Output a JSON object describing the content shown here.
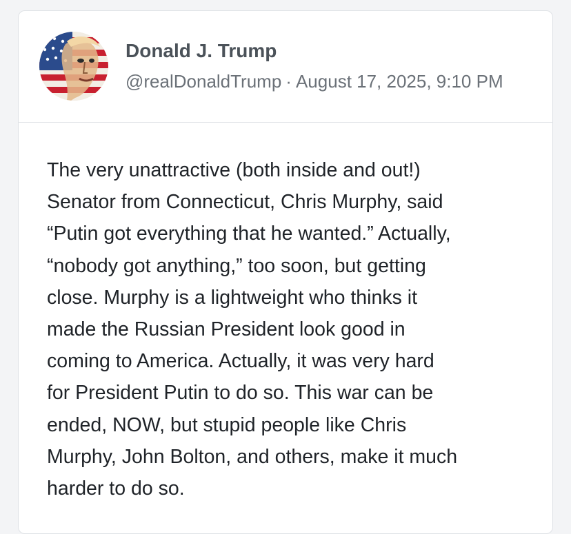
{
  "post": {
    "author_name": "Donald J. Trump",
    "handle": "@realDonaldTrump",
    "separator": "·",
    "timestamp": "August 17, 2025, 9:10 PM",
    "avatar_icon": "flag-portrait-avatar",
    "lines": [
      "The very unattractive (both inside and out!)",
      "Senator from Connecticut, Chris Murphy, said",
      "“Putin got everything that he wanted.” Actually,",
      "“nobody got anything,” too soon, but getting",
      "close. Murphy is a lightweight who thinks it",
      "made the Russian President look good in",
      "coming to America. Actually, it was very hard",
      "for President Putin to do so. This war can be",
      "ended, NOW, but stupid people like Chris",
      "Murphy, John Bolton, and others, make it much",
      "harder to do so."
    ]
  },
  "colors": {
    "background": "#f3f4f6",
    "card": "#ffffff",
    "border": "#dfe2e6",
    "name": "#4b5259",
    "meta": "#6b7178",
    "text": "#1f2328",
    "flag_red": "#c8202f",
    "flag_blue": "#2b4b8c"
  }
}
